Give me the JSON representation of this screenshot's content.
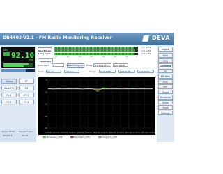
{
  "header": {
    "title": "DB4402-V2.1 - FM Radio Monitoring Receiver",
    "logo": "DEVA",
    "colors": {
      "bar": "#4a7aa6",
      "text": "#ffffff"
    }
  },
  "display": {
    "frequency": "92.10",
    "unit": "MHz",
    "rds_text": "RDS",
    "level_bar_fraction": 0.72
  },
  "left_buttons": [
    {
      "label": "Stereo",
      "active": true
    },
    {
      "label": "RF",
      "active": false
    },
    {
      "label": "Save FM",
      "active": false
    },
    {
      "label": "FM",
      "active": false
    },
    {
      "label": "F1 1",
      "active": false
    },
    {
      "label": "F1 2",
      "active": false
    },
    {
      "label": "F1 3",
      "active": false
    },
    {
      "label": "F1 4",
      "active": false
    }
  ],
  "footer": {
    "date": "18 Jun 20:37",
    "session_label": "Session Users",
    "time": "08:00:11",
    "count": "00:01"
  },
  "levels": {
    "rows": [
      {
        "label": "Momentary",
        "fill": 0.96,
        "value": "-7.1 LUFS"
      },
      {
        "label": "Short term",
        "fill": 0.97,
        "value": "-7.0 LUFS"
      },
      {
        "label": "Long term",
        "fill": 0.95,
        "value": "-7.3 LUFS"
      }
    ],
    "scale": [
      "-70",
      "-60",
      "-50",
      "-40",
      "-30",
      "-20",
      "-10",
      "0"
    ]
  },
  "tabs": [
    {
      "label": "Loudness",
      "selected": true
    }
  ],
  "controls": {
    "long_term_label": "Long-term",
    "long_term_value": "0",
    "reset_button": "Reset Long term",
    "mode_label": "Mode",
    "mode_value": "ITU BS.1770-3",
    "mode_value2": "EBU R128",
    "span_label": "Span",
    "span_value1": "30 sec",
    "span_value2": "120 sec",
    "range_label": "Range",
    "range_value1": "0-70 LUFS",
    "range_value2": "0-50 LUFS",
    "range_value3": "0-70 LUFS"
  },
  "chart_data": {
    "type": "line",
    "ylim": [
      -40,
      0
    ],
    "yticks": [
      "0",
      "-10",
      "-20",
      "-30",
      "-40"
    ],
    "xticks": [
      "16:09:00",
      "16:09:10",
      "16:09:20",
      "16:09:30",
      "16:09:40",
      "16:09:50",
      "16:10:00",
      "16:10:10",
      "16:10:20",
      "16:10:30",
      "16:10:40",
      "16:10:50",
      "16:11:00",
      "16:11:10"
    ],
    "series": [
      {
        "name": "Momentary_LUFS",
        "color": "#38d838",
        "values": [
          -7,
          -7.5,
          -7.2,
          -7.4,
          -7.1,
          -7.3,
          -7.2,
          -7.5,
          -7.0,
          -7.3,
          -9.5,
          -6.5,
          -7.2,
          -7.3,
          -7.1,
          -7.4,
          -7.2,
          -7.0,
          -7.3,
          -7.2,
          -7.4,
          -7.1
        ]
      },
      {
        "name": "Short-term_LUFS",
        "color": "#e03c3c",
        "values": [
          -7.3,
          -7.3,
          -7.4,
          -7.3,
          -7.3,
          -7.3,
          -7.4,
          -7.4,
          -7.3,
          -7.4,
          -8.2,
          -7.0,
          -7.3,
          -7.3,
          -7.3,
          -7.3,
          -7.3,
          -7.3,
          -7.3,
          -7.3,
          -7.3,
          -7.3
        ]
      },
      {
        "name": "Long-term_LUFS",
        "color": "#f2f2f2",
        "values": [
          -7.4,
          -7.4,
          -7.4,
          -7.4,
          -7.4,
          -7.4,
          -7.4,
          -7.4,
          -7.4,
          -7.4,
          -7.6,
          -7.4,
          -7.4,
          -7.4,
          -7.4,
          -7.4,
          -7.4,
          -7.4,
          -7.4,
          -7.4,
          -7.4,
          -7.4
        ]
      }
    ],
    "grid": true,
    "legend": "bottom"
  },
  "nav": [
    {
      "label": "Logout",
      "selected": false
    },
    {
      "label": "Main",
      "selected": false
    },
    {
      "label": "MPX",
      "selected": false
    },
    {
      "label": "Loudness",
      "selected": true
    },
    {
      "label": "RF",
      "selected": false
    },
    {
      "label": "FM Stats",
      "selected": false
    },
    {
      "label": "RDS",
      "selected": false
    },
    {
      "label": "MPT",
      "selected": false
    },
    {
      "label": "Scope",
      "selected": false
    },
    {
      "label": "Bandscan",
      "selected": false
    },
    {
      "label": "Alarm",
      "selected": false
    },
    {
      "label": "Store",
      "selected": false
    },
    {
      "label": "Settings",
      "selected": false
    }
  ]
}
